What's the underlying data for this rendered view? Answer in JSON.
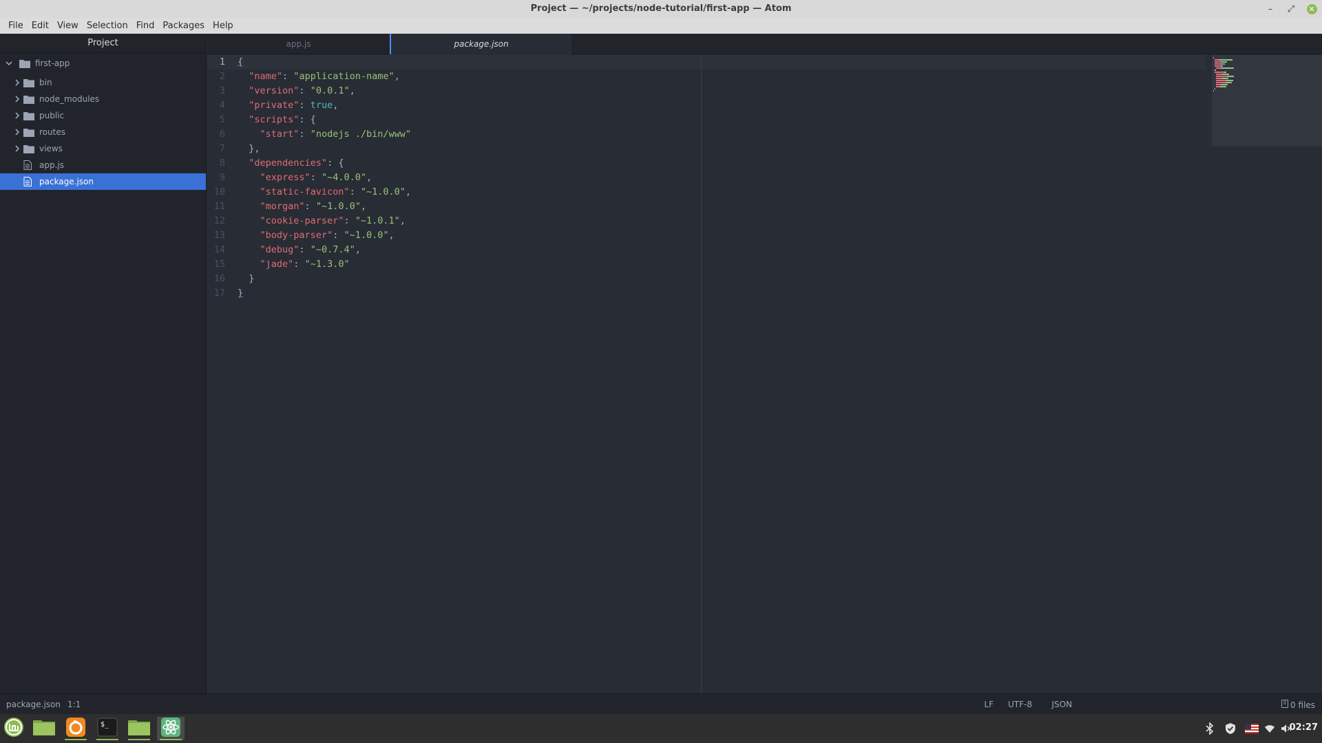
{
  "window": {
    "title": "Project — ~/projects/node-tutorial/first-app — Atom",
    "minimize": "–",
    "maximize": "⤢",
    "close": "✕"
  },
  "menu": [
    "File",
    "Edit",
    "View",
    "Selection",
    "Find",
    "Packages",
    "Help"
  ],
  "tree": {
    "header": "Project",
    "root": "first-app",
    "items": [
      {
        "label": "bin",
        "type": "folder"
      },
      {
        "label": "node_modules",
        "type": "folder"
      },
      {
        "label": "public",
        "type": "folder"
      },
      {
        "label": "routes",
        "type": "folder"
      },
      {
        "label": "views",
        "type": "folder"
      },
      {
        "label": "app.js",
        "type": "file"
      },
      {
        "label": "package.json",
        "type": "file",
        "selected": true
      }
    ]
  },
  "tabs": [
    {
      "label": "app.js",
      "active": false
    },
    {
      "label": "package.json",
      "active": true
    }
  ],
  "editor": {
    "lines": [
      [
        [
          "p",
          "{"
        ]
      ],
      [
        [
          "p",
          "  "
        ],
        [
          "k",
          "\"name\""
        ],
        [
          "p",
          ": "
        ],
        [
          "s",
          "\"application-name\""
        ],
        [
          "p",
          ","
        ]
      ],
      [
        [
          "p",
          "  "
        ],
        [
          "k",
          "\"version\""
        ],
        [
          "p",
          ": "
        ],
        [
          "s",
          "\"0.0.1\""
        ],
        [
          "p",
          ","
        ]
      ],
      [
        [
          "p",
          "  "
        ],
        [
          "k",
          "\"private\""
        ],
        [
          "p",
          ": "
        ],
        [
          "b",
          "true"
        ],
        [
          "p",
          ","
        ]
      ],
      [
        [
          "p",
          "  "
        ],
        [
          "k",
          "\"scripts\""
        ],
        [
          "p",
          ": {"
        ]
      ],
      [
        [
          "p",
          "    "
        ],
        [
          "k",
          "\"start\""
        ],
        [
          "p",
          ": "
        ],
        [
          "s",
          "\"nodejs ./bin/www\""
        ]
      ],
      [
        [
          "p",
          "  },"
        ]
      ],
      [
        [
          "p",
          "  "
        ],
        [
          "k",
          "\"dependencies\""
        ],
        [
          "p",
          ": {"
        ]
      ],
      [
        [
          "p",
          "    "
        ],
        [
          "k",
          "\"express\""
        ],
        [
          "p",
          ": "
        ],
        [
          "s",
          "\"~4.0.0\""
        ],
        [
          "p",
          ","
        ]
      ],
      [
        [
          "p",
          "    "
        ],
        [
          "k",
          "\"static-favicon\""
        ],
        [
          "p",
          ": "
        ],
        [
          "s",
          "\"~1.0.0\""
        ],
        [
          "p",
          ","
        ]
      ],
      [
        [
          "p",
          "    "
        ],
        [
          "k",
          "\"morgan\""
        ],
        [
          "p",
          ": "
        ],
        [
          "s",
          "\"~1.0.0\""
        ],
        [
          "p",
          ","
        ]
      ],
      [
        [
          "p",
          "    "
        ],
        [
          "k",
          "\"cookie-parser\""
        ],
        [
          "p",
          ": "
        ],
        [
          "s",
          "\"~1.0.1\""
        ],
        [
          "p",
          ","
        ]
      ],
      [
        [
          "p",
          "    "
        ],
        [
          "k",
          "\"body-parser\""
        ],
        [
          "p",
          ": "
        ],
        [
          "s",
          "\"~1.0.0\""
        ],
        [
          "p",
          ","
        ]
      ],
      [
        [
          "p",
          "    "
        ],
        [
          "k",
          "\"debug\""
        ],
        [
          "p",
          ": "
        ],
        [
          "s",
          "\"~0.7.4\""
        ],
        [
          "p",
          ","
        ]
      ],
      [
        [
          "p",
          "    "
        ],
        [
          "k",
          "\"jade\""
        ],
        [
          "p",
          ": "
        ],
        [
          "s",
          "\"~1.3.0\""
        ]
      ],
      [
        [
          "p",
          "  }"
        ]
      ],
      [
        [
          "p",
          "}"
        ]
      ]
    ]
  },
  "status": {
    "file": "package.json",
    "cursor": "1:1",
    "line_ending": "LF",
    "encoding": "UTF-8",
    "grammar": "JSON",
    "git": "0 files"
  },
  "taskbar": {
    "clock": "02:27",
    "apps": [
      "mint-menu",
      "files",
      "firefox",
      "terminal",
      "files",
      "atom"
    ]
  }
}
